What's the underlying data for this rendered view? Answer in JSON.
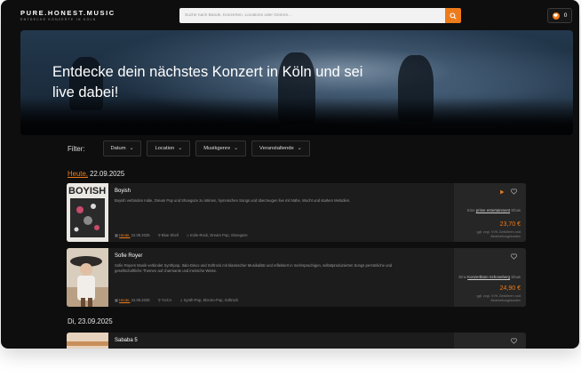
{
  "logo": {
    "title": "PURE.HONEST.MUSIC",
    "subtitle": "ENTDECKE KONZERTE IN KÖLN"
  },
  "search": {
    "placeholder": "Suche nach Bands, Konzerten, Locations oder Genres..."
  },
  "cart": {
    "count": "0"
  },
  "hero": {
    "headline": "Entdecke dein nächstes Konzert in Köln und sei live dabei!"
  },
  "filter": {
    "label": "Filter:",
    "buttons": [
      "Datum",
      "Location",
      "Musikgenre",
      "Veranstaltende"
    ]
  },
  "days": [
    {
      "today_label": "Heute,",
      "date": "22.09.2025"
    },
    {
      "date_label": "Di, 23.09.2025"
    }
  ],
  "events": [
    {
      "title": "Boyish",
      "description": "Boyish verbinden Indie, Dream Pop und Shoegaze zu intimen, hymnischen Songs und überzeugen live mit Nähe, Wucht und starken Melodien.",
      "date_today": "Heute,",
      "date": "22.09.2025",
      "location": "Blue Shell",
      "genre": "Indie-Rock, Dream Pop, Shoegaze",
      "org_prefix": "Eine",
      "organizer": "prime entertainment",
      "org_suffix": "Show",
      "price": "23,70 €",
      "fee": "ggf. zzgl. VVK-Gebühren und Bearbeitungskosten"
    },
    {
      "title": "Sofie Royer",
      "description": "Sofie Royers Musik verbindet Synthpop, Italo-Disco und Softrock mit klassischer Musikalität und reflektiert in mehrsprachigen, selbstproduzierten Songs persönliche und gesellschaftliche Themen auf charmante und ironische Weise.",
      "date_today": "Heute,",
      "date": "22.09.2025",
      "location": "YUCA",
      "genre": "Synth-Pop, Electro-Pop, Softrock",
      "org_prefix": "Eine",
      "organizer": "Konzertbüro Schoneberg",
      "org_suffix": "Show",
      "price": "24,90 €",
      "fee": "ggf. zzgl. VVK-Gebühren und Bearbeitungskosten"
    },
    {
      "title": "Sababa 5"
    }
  ]
}
